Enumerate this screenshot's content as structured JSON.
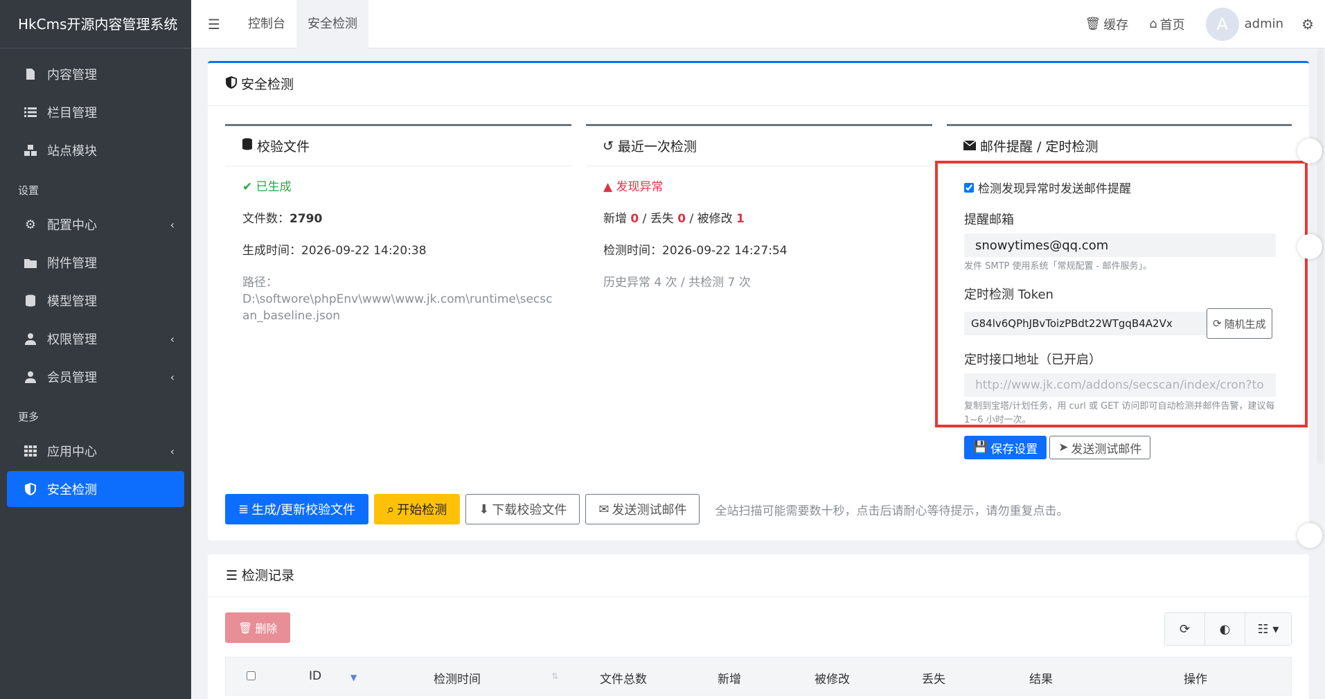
{
  "app": {
    "brand": "HkCms开源内容管理系统"
  },
  "sidebar": {
    "items_top": [
      {
        "label": "内容管理",
        "icon": "file-icon"
      },
      {
        "label": "栏目管理",
        "icon": "list-icon"
      },
      {
        "label": "站点模块",
        "icon": "cubes-icon"
      }
    ],
    "section_settings": "设置",
    "items_settings": [
      {
        "label": "配置中心",
        "icon": "gear-icon",
        "chevron": true
      },
      {
        "label": "附件管理",
        "icon": "folder-icon",
        "chevron": false
      },
      {
        "label": "模型管理",
        "icon": "database-icon",
        "chevron": false
      },
      {
        "label": "权限管理",
        "icon": "user-icon",
        "chevron": true
      },
      {
        "label": "会员管理",
        "icon": "user-tie-icon",
        "chevron": true
      }
    ],
    "section_more": "更多",
    "items_more": [
      {
        "label": "应用中心",
        "icon": "grid-icon",
        "chevron": true
      },
      {
        "label": "安全检测",
        "icon": "shield-icon",
        "chevron": false,
        "active": true
      }
    ]
  },
  "topbar": {
    "tabs": [
      "控制台",
      "安全检测"
    ],
    "cache": "缓存",
    "home": "首页",
    "avatar_letter": "A",
    "username": "admin"
  },
  "main": {
    "title": "安全检测",
    "baseline": {
      "title": "校验文件",
      "status": "已生成",
      "file_count_label": "文件数：",
      "file_count": "2790",
      "generated_label": "生成时间：",
      "generated_at": "2026-09-22 14:20:38",
      "path_label": "路径：",
      "path": "D:\\softwore\\phpEnv\\www\\www.jk.com\\runtime\\secscan_baseline.json"
    },
    "last_scan": {
      "title": "最近一次检测",
      "status": "发现异常",
      "added_label": "新增",
      "added": "0",
      "lost_label": "丢失",
      "lost": "0",
      "modified_label": "被修改",
      "modified": "1",
      "sep": " / ",
      "scan_time_label": "检测时间：",
      "scan_time": "2026-09-22 14:27:54",
      "history": "历史异常 4 次 / 共检测 7 次"
    },
    "mail": {
      "title": "邮件提醒 / 定时检测",
      "checkbox_label": "检测发现异常时发送邮件提醒",
      "email_label": "提醒邮箱",
      "email_value": "snowytimes@qq.com",
      "email_hint": "发件 SMTP 使用系统「常规配置 - 邮件服务」。",
      "token_label": "定时检测 Token",
      "token_value": "G84lv6QPhJBvToizPBdt22WTgqB4A2Vx",
      "random_btn": "随机生成",
      "cron_label": "定时接口地址（已开启）",
      "cron_url": "http://www.jk.com/addons/secscan/index/cron?tok",
      "cron_hint": "复制到宝塔/计划任务，用 curl 或 GET 访问即可自动检测并邮件告警，建议每 1~6 小时一次。",
      "save_btn": "保存设置",
      "test_btn": "发送测试邮件"
    },
    "actions": {
      "generate": "生成/更新校验文件",
      "start": "开始检测",
      "download": "下载校验文件",
      "test_mail": "发送测试邮件",
      "note": "全站扫描可能需要数十秒，点击后请耐心等待提示，请勿重复点击。"
    }
  },
  "records": {
    "title": "检测记录",
    "delete_btn": "删除",
    "columns": [
      "ID",
      "检测时间",
      "文件总数",
      "新增",
      "被修改",
      "丢失",
      "结果",
      "操作"
    ]
  },
  "colors": {
    "primary": "#0d6efd",
    "warning": "#ffc107",
    "danger": "#dc3545",
    "success": "#28a745",
    "sidebar": "#343a40"
  }
}
